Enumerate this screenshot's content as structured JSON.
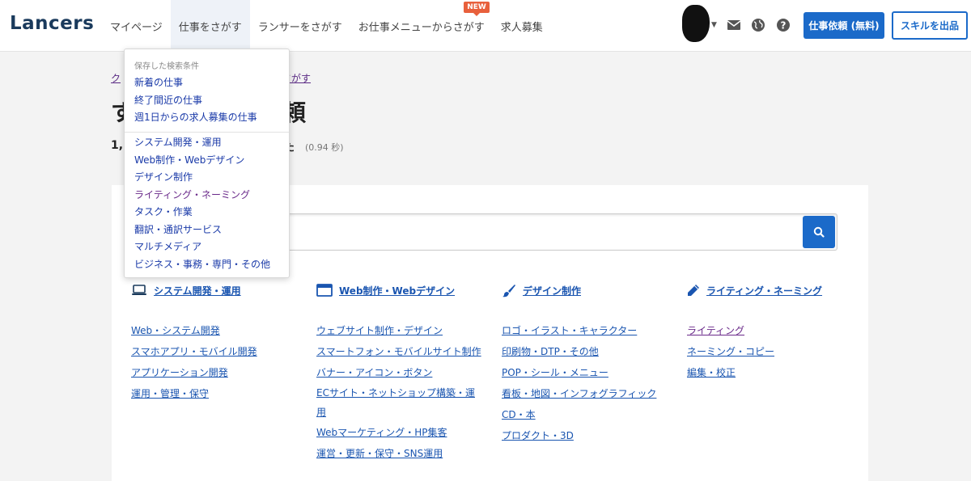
{
  "header": {
    "logo": "Lancers",
    "nav": [
      {
        "label": "マイページ"
      },
      {
        "label": "仕事をさがす"
      },
      {
        "label": "ランサーをさがす"
      },
      {
        "label": "お仕事メニューからさがす",
        "badge": "NEW"
      },
      {
        "label": "求人募集"
      }
    ],
    "icons": [
      "mail-icon",
      "globe-icon",
      "help-icon"
    ],
    "primary_button": "仕事依頼 (無料)",
    "outline_button": "スキルを出品"
  },
  "page": {
    "breadcrumb_start": "ク",
    "breadcrumb_end": "さがす",
    "title_left": "す",
    "title_right": "頼",
    "count_left": "1,",
    "count_right": "た",
    "timing": "(0.94 秒)"
  },
  "dropdown": {
    "caption": "保存した検索条件",
    "saved": [
      "新着の仕事",
      "終了間近の仕事",
      "週1日からの求人募集の仕事"
    ],
    "categories": [
      {
        "label": "システム開発・運用",
        "visited": false
      },
      {
        "label": "Web制作・Webデザイン",
        "visited": false
      },
      {
        "label": "デザイン制作",
        "visited": false
      },
      {
        "label": "ライティング・ネーミング",
        "visited": true
      },
      {
        "label": "タスク・作業",
        "visited": false
      },
      {
        "label": "翻訳・通訳サービス",
        "visited": false
      },
      {
        "label": "マルチメディア",
        "visited": false
      },
      {
        "label": "ビジネス・事務・専門・その他",
        "visited": false
      }
    ]
  },
  "search": {
    "placeholder": ""
  },
  "columns": [
    {
      "title": "システム開発・運用",
      "icon": "laptop-icon",
      "links": [
        {
          "label": "Web・システム開発"
        },
        {
          "label": "スマホアプリ・モバイル開発"
        },
        {
          "label": "アプリケーション開発"
        },
        {
          "label": "運用・管理・保守"
        }
      ]
    },
    {
      "title": "Web制作・Webデザイン",
      "icon": "browser-window-icon",
      "links": [
        {
          "label": "ウェブサイト制作・デザイン"
        },
        {
          "label": "スマートフォン・モバイルサイト制作"
        },
        {
          "label": "バナー・アイコン・ボタン"
        },
        {
          "label": "ECサイト・ネットショップ構築・運用"
        },
        {
          "label": "Webマーケティング・HP集客"
        },
        {
          "label": "運営・更新・保守・SNS運用"
        }
      ]
    },
    {
      "title": "デザイン制作",
      "icon": "paintbrush-icon",
      "links": [
        {
          "label": "ロゴ・イラスト・キャラクター"
        },
        {
          "label": "印刷物・DTP・その他"
        },
        {
          "label": "POP・シール・メニュー"
        },
        {
          "label": "看板・地図・インフォグラフィック"
        },
        {
          "label": "CD・本"
        },
        {
          "label": "プロダクト・3D"
        }
      ]
    },
    {
      "title": "ライティング・ネーミング",
      "icon": "pencil-icon",
      "links": [
        {
          "label": "ライティング",
          "visited": true
        },
        {
          "label": "ネーミング・コピー"
        },
        {
          "label": "編集・校正"
        }
      ]
    }
  ],
  "colors": {
    "brand": "#1b6ac9",
    "link": "#1a55b0",
    "visited": "#6a2a8a",
    "badge": "#e8603c"
  }
}
